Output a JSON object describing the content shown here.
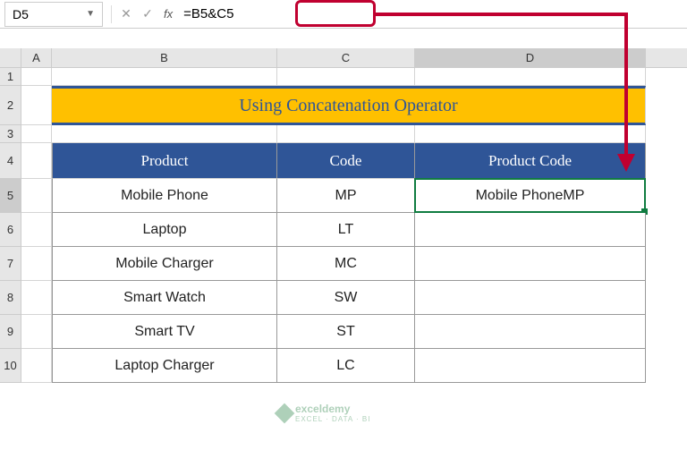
{
  "formula_bar": {
    "name_box": "D5",
    "formula": "=B5&C5"
  },
  "columns": [
    "A",
    "B",
    "C",
    "D"
  ],
  "row_labels": [
    "1",
    "2",
    "3",
    "4",
    "5",
    "6",
    "7",
    "8",
    "9",
    "10"
  ],
  "title": "Using Concatenation Operator",
  "headers": {
    "product": "Product",
    "code": "Code",
    "product_code": "Product Code"
  },
  "rows": [
    {
      "product": "Mobile Phone",
      "code": "MP",
      "result": "Mobile PhoneMP"
    },
    {
      "product": "Laptop",
      "code": "LT",
      "result": ""
    },
    {
      "product": "Mobile Charger",
      "code": "MC",
      "result": ""
    },
    {
      "product": "Smart Watch",
      "code": "SW",
      "result": ""
    },
    {
      "product": "Smart TV",
      "code": "ST",
      "result": ""
    },
    {
      "product": "Laptop Charger",
      "code": "LC",
      "result": ""
    }
  ],
  "watermark": {
    "name": "exceldemy",
    "tag": "EXCEL · DATA · BI"
  },
  "active_cell": "D5"
}
